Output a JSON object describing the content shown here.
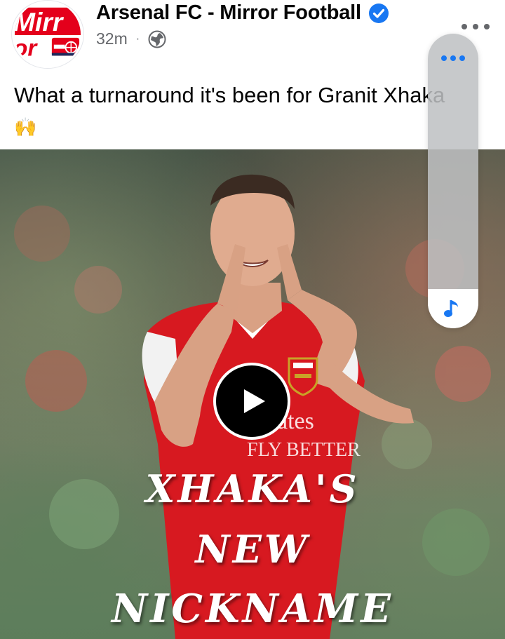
{
  "post": {
    "page_name": "Arsenal FC - Mirror Football",
    "timestamp": "32m",
    "separator": "·",
    "text": "What a turnaround it's been for Granit Xhaka",
    "emoji": "🙌"
  },
  "avatar": {
    "logo_text_top": "Mirr",
    "logo_text_bottom": "or",
    "colors": {
      "brand_red": "#e4001b",
      "navy": "#1b2a5c"
    }
  },
  "media": {
    "type": "video",
    "caption_lines": [
      "Xhaka's",
      "New",
      "Nickname"
    ]
  },
  "icons": {
    "verified": "verified-badge-icon",
    "audience": "globe-icon",
    "more": "more-options-icon",
    "play": "play-icon",
    "music": "music-note-icon"
  },
  "colors": {
    "facebook_blue": "#1877f2",
    "secondary_text": "#65676b",
    "primary_text": "#050505",
    "kit_red": "#d71920"
  }
}
